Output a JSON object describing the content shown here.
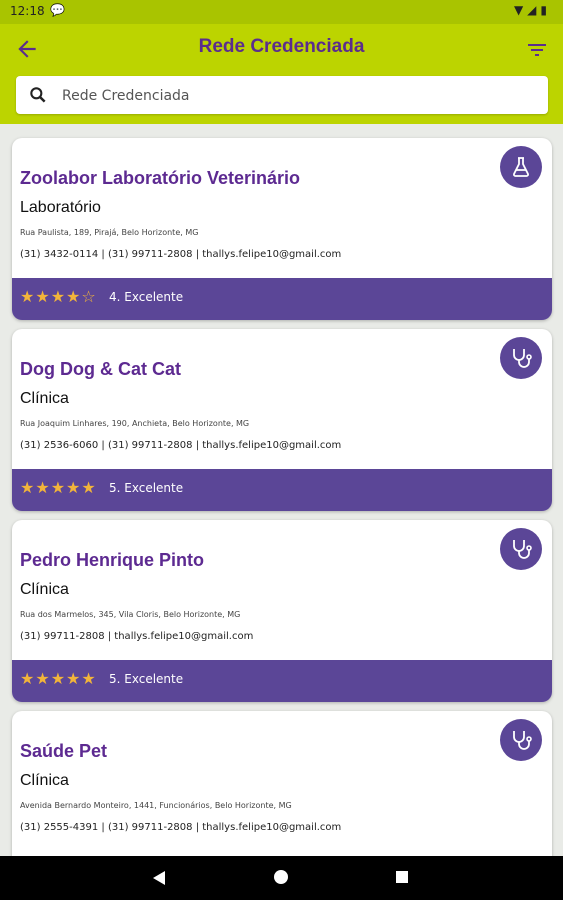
{
  "status_bar": {
    "time": "12:18",
    "notification_icon": "chat-icon",
    "icons": "wifi-icon signal-icon battery-icon"
  },
  "app_bar": {
    "title": "Rede Credenciada",
    "back_icon": "arrow-left-icon",
    "filter_icon": "filter-icon"
  },
  "search": {
    "placeholder": "Rede Credenciada"
  },
  "colors": {
    "app_bar": "#bcd400",
    "accent_purple": "#5b4697",
    "title_purple": "#5d2a91",
    "star": "#f2b43a"
  },
  "cards": [
    {
      "name": "Zoolabor Laboratório Veterinário",
      "type": "Laboratório",
      "address": "Rua Paulista, 189, Pirajá, Belo Horizonte, MG",
      "contacts": "(31) 3432-0114 | (31) 99711-2808 | thallys.felipe10@gmail.com",
      "icon": "flask-icon",
      "stars": "★★★★☆",
      "rating_value": 4,
      "rating_text": "4. Excelente"
    },
    {
      "name": "Dog Dog & Cat Cat",
      "type": "Clínica",
      "address": "Rua Joaquim Linhares, 190, Anchieta, Belo Horizonte, MG",
      "contacts": "(31) 2536-6060 | (31) 99711-2808 | thallys.felipe10@gmail.com",
      "icon": "stethoscope-icon",
      "stars": "★★★★★",
      "rating_value": 5,
      "rating_text": "5. Excelente"
    },
    {
      "name": "Pedro Henrique Pinto",
      "type": "Clínica",
      "address": "Rua dos Marmelos, 345, Vila Cloris, Belo Horizonte, MG",
      "contacts": "(31) 99711-2808 | thallys.felipe10@gmail.com",
      "icon": "stethoscope-icon",
      "stars": "★★★★★",
      "rating_value": 5,
      "rating_text": "5. Excelente"
    },
    {
      "name": "Saúde Pet",
      "type": "Clínica",
      "address": "Avenida Bernardo Monteiro, 1441, Funcionários, Belo Horizonte, MG",
      "contacts": "(31) 2555-4391 | (31) 99711-2808 | thallys.felipe10@gmail.com",
      "icon": "stethoscope-icon"
    }
  ]
}
